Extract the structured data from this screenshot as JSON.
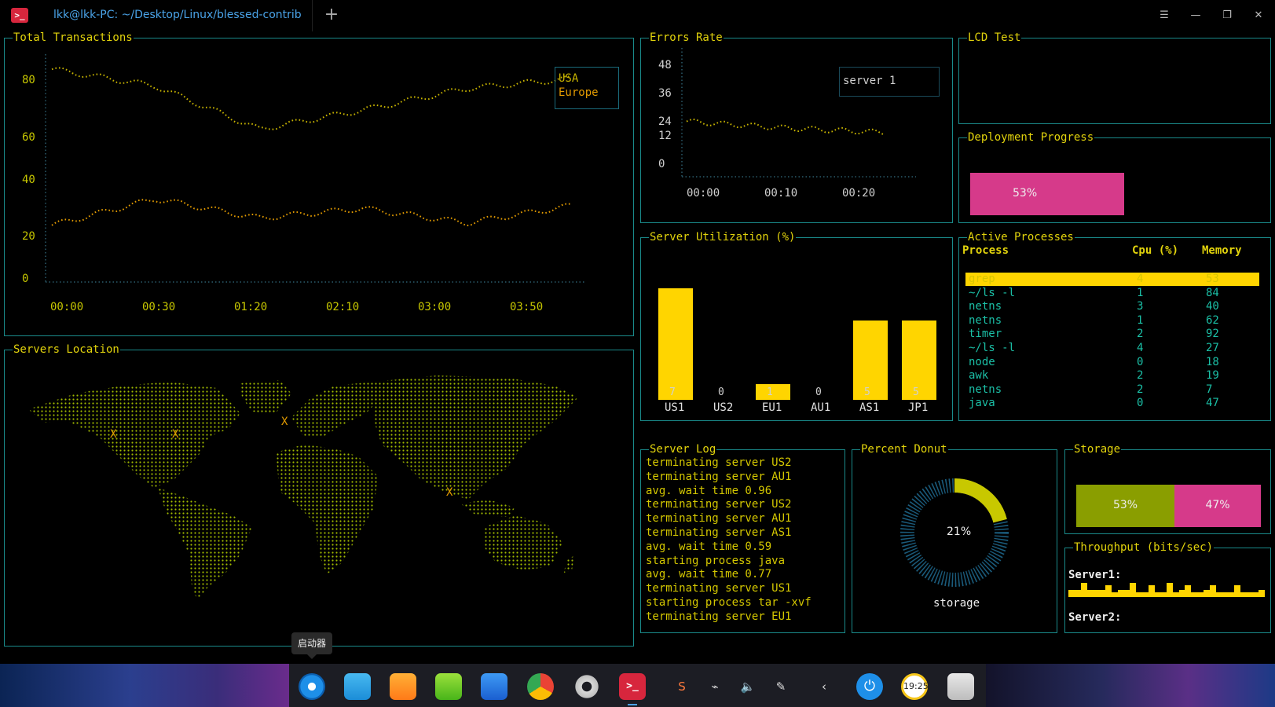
{
  "titlebar": {
    "title": "lkk@lkk-PC: ~/Desktop/Linux/blessed-contrib",
    "add_tab": "+",
    "menu": "☰",
    "minimize": "—",
    "maximize": "❐",
    "close": "✕"
  },
  "panels": {
    "transactions": {
      "title": "Total Transactions",
      "legend": [
        "USA",
        "Europe"
      ],
      "yticks": [
        "80",
        "60",
        "40",
        "20",
        "0"
      ],
      "xticks": [
        "00:00",
        "00:30",
        "01:20",
        "02:10",
        "03:00",
        "03:50"
      ]
    },
    "errors": {
      "title": "Errors Rate",
      "legend": [
        "server 1"
      ],
      "yticks": [
        "48",
        "36",
        "24",
        "12",
        "0"
      ],
      "xticks": [
        "00:00",
        "00:10",
        "00:20"
      ]
    },
    "lcd": {
      "title": "LCD Test"
    },
    "deployment": {
      "title": "Deployment Progress",
      "percent_label": "53%",
      "progress": 0.53
    },
    "utilization": {
      "title": "Server Utilization (%)"
    },
    "processes": {
      "title": "Active Processes",
      "headers": [
        "Process",
        "Cpu (%)",
        "Memory"
      ],
      "rows": [
        {
          "name": "grep",
          "cpu": "4",
          "mem": "53"
        },
        {
          "name": "~/ls -l",
          "cpu": "1",
          "mem": "84"
        },
        {
          "name": "netns",
          "cpu": "3",
          "mem": "40"
        },
        {
          "name": "netns",
          "cpu": "1",
          "mem": "62"
        },
        {
          "name": "timer",
          "cpu": "2",
          "mem": "92"
        },
        {
          "name": "~/ls -l",
          "cpu": "4",
          "mem": "27"
        },
        {
          "name": "node",
          "cpu": "0",
          "mem": "18"
        },
        {
          "name": "awk",
          "cpu": "2",
          "mem": "19"
        },
        {
          "name": "netns",
          "cpu": "2",
          "mem": "7"
        },
        {
          "name": "java",
          "cpu": "0",
          "mem": "47"
        }
      ]
    },
    "servers_location": {
      "title": "Servers Location",
      "markers": [
        "X",
        "X",
        "X",
        "X"
      ]
    },
    "server_log": {
      "title": "Server Log",
      "lines": [
        "terminating server US2",
        "terminating server AU1",
        "avg. wait time 0.96",
        "terminating server US2",
        "terminating server AU1",
        "terminating server AS1",
        "avg. wait time 0.59",
        "starting process java",
        "avg. wait time 0.77",
        "terminating server US1",
        "starting process tar -xvf",
        "terminating server EU1"
      ]
    },
    "donut": {
      "title": "Percent Donut",
      "percent_label": "21%",
      "value": 0.21,
      "label": "storage"
    },
    "storage": {
      "title": "Storage",
      "segments": [
        {
          "label": "53%",
          "value": 0.53
        },
        {
          "label": "47%",
          "value": 0.47
        }
      ]
    },
    "throughput": {
      "title": "Throughput (bits/sec)",
      "server1": "Server1:",
      "server2": "Server2:"
    }
  },
  "taskbar": {
    "launcher_tooltip": "启动器",
    "clock_label": "19:25",
    "apps": [
      "launcher-icon",
      "file-manager-icon",
      "app-store-icon",
      "music-icon",
      "video-icon",
      "chrome-icon",
      "settings-icon",
      "terminal-icon"
    ]
  },
  "colors": {
    "border": "#1a8a8a",
    "title": "#e2d30c",
    "usa": "#c8b400",
    "europe": "#e39b00",
    "bar": "#ffd500",
    "magenta": "#d63a8a",
    "olive": "#8a9e00",
    "teal_text": "#1bbfa6"
  },
  "chart_data": [
    {
      "type": "line",
      "name": "Total Transactions",
      "x": [
        "00:00",
        "00:30",
        "01:20",
        "02:10",
        "03:00",
        "03:50"
      ],
      "series": [
        {
          "name": "USA",
          "values": [
            87,
            80,
            62,
            70,
            79,
            83
          ]
        },
        {
          "name": "Europe",
          "values": [
            22,
            33,
            25,
            29,
            23,
            30
          ]
        }
      ],
      "ylim": [
        0,
        90
      ]
    },
    {
      "type": "line",
      "name": "Errors Rate",
      "x": [
        "00:00",
        "00:10",
        "00:20"
      ],
      "series": [
        {
          "name": "server 1",
          "values": [
            23,
            20,
            18
          ]
        }
      ],
      "ylim": [
        0,
        50
      ]
    },
    {
      "type": "bar",
      "name": "Server Utilization (%)",
      "categories": [
        "US1",
        "US2",
        "EU1",
        "AU1",
        "AS1",
        "JP1"
      ],
      "values": [
        7,
        0,
        1,
        0,
        5,
        5
      ],
      "value_labels": [
        "7",
        "0",
        "1",
        "0",
        "5",
        "5"
      ],
      "ylim": [
        0,
        7
      ]
    },
    {
      "type": "bar",
      "name": "Throughput (bits/sec)",
      "series": [
        {
          "name": "Server1",
          "values": [
            3,
            3,
            6,
            3,
            3,
            3,
            5,
            2,
            3,
            3,
            6,
            2,
            2,
            5,
            2,
            2,
            6,
            2,
            3,
            5,
            2,
            2,
            3,
            5,
            2,
            2,
            2,
            5,
            2,
            2,
            2,
            3
          ]
        }
      ]
    }
  ]
}
